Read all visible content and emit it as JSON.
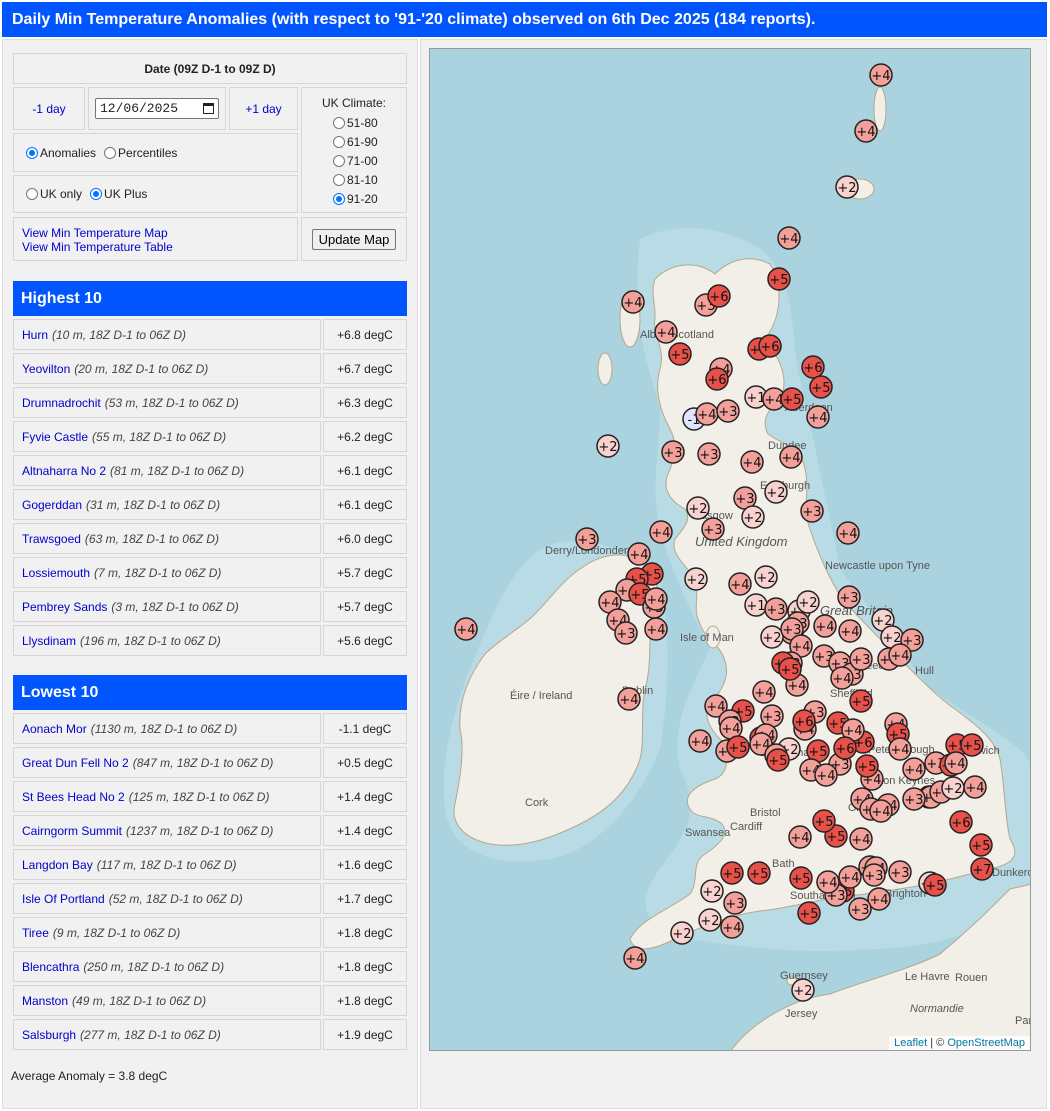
{
  "title": "Daily Min Temperature Anomalies (with respect to '91-'20 climate) observed on 6th Dec 2025 (184 reports).",
  "controls": {
    "date_header": "Date (09Z D-1 to 09Z D)",
    "prev_day": "-1 day",
    "next_day": "+1 day",
    "date_value": "12/06/2025",
    "mode_options": [
      "Anomalies",
      "Percentiles"
    ],
    "mode_selected": "Anomalies",
    "region_options": [
      "UK only",
      "UK Plus"
    ],
    "region_selected": "UK Plus",
    "climate_label": "UK Climate:",
    "climate_options": [
      "51-80",
      "61-90",
      "71-00",
      "81-10",
      "91-20"
    ],
    "climate_selected": "91-20",
    "map_link": "View Min Temperature Map",
    "table_link": "View Min Temperature Table",
    "update_button": "Update Map"
  },
  "highest": {
    "title": "Highest 10",
    "rows": [
      {
        "name": "Hurn",
        "meta": "(10 m, 18Z D-1 to 06Z D)",
        "value": "+6.8 degC"
      },
      {
        "name": "Yeovilton",
        "meta": "(20 m, 18Z D-1 to 06Z D)",
        "value": "+6.7 degC"
      },
      {
        "name": "Drumnadrochit",
        "meta": "(53 m, 18Z D-1 to 06Z D)",
        "value": "+6.3 degC"
      },
      {
        "name": "Fyvie Castle",
        "meta": "(55 m, 18Z D-1 to 06Z D)",
        "value": "+6.2 degC"
      },
      {
        "name": "Altnaharra No 2",
        "meta": "(81 m, 18Z D-1 to 06Z D)",
        "value": "+6.1 degC"
      },
      {
        "name": "Gogerddan",
        "meta": "(31 m, 18Z D-1 to 06Z D)",
        "value": "+6.1 degC"
      },
      {
        "name": "Trawsgoed",
        "meta": "(63 m, 18Z D-1 to 06Z D)",
        "value": "+6.0 degC"
      },
      {
        "name": "Lossiemouth",
        "meta": "(7 m, 18Z D-1 to 06Z D)",
        "value": "+5.7 degC"
      },
      {
        "name": "Pembrey Sands",
        "meta": "(3 m, 18Z D-1 to 06Z D)",
        "value": "+5.7 degC"
      },
      {
        "name": "Llysdinam",
        "meta": "(196 m, 18Z D-1 to 06Z D)",
        "value": "+5.6 degC"
      }
    ]
  },
  "lowest": {
    "title": "Lowest 10",
    "rows": [
      {
        "name": "Aonach Mor",
        "meta": "(1130 m, 18Z D-1 to 06Z D)",
        "value": "-1.1 degC"
      },
      {
        "name": "Great Dun Fell No 2",
        "meta": "(847 m, 18Z D-1 to 06Z D)",
        "value": "+0.5 degC"
      },
      {
        "name": "St Bees Head No 2",
        "meta": "(125 m, 18Z D-1 to 06Z D)",
        "value": "+1.4 degC"
      },
      {
        "name": "Cairngorm Summit",
        "meta": "(1237 m, 18Z D-1 to 06Z D)",
        "value": "+1.4 degC"
      },
      {
        "name": "Langdon Bay",
        "meta": "(117 m, 18Z D-1 to 06Z D)",
        "value": "+1.6 degC"
      },
      {
        "name": "Isle Of Portland",
        "meta": "(52 m, 18Z D-1 to 06Z D)",
        "value": "+1.7 degC"
      },
      {
        "name": "Tiree",
        "meta": "(9 m, 18Z D-1 to 06Z D)",
        "value": "+1.8 degC"
      },
      {
        "name": "Blencathra",
        "meta": "(250 m, 18Z D-1 to 06Z D)",
        "value": "+1.8 degC"
      },
      {
        "name": "Manston",
        "meta": "(49 m, 18Z D-1 to 06Z D)",
        "value": "+1.8 degC"
      },
      {
        "name": "Salsburgh",
        "meta": "(277 m, 18Z D-1 to 06Z D)",
        "value": "+1.9 degC"
      }
    ]
  },
  "average": "Average Anomaly = 3.8 degC",
  "map": {
    "place_labels": [
      "Dundee",
      "Edinburgh",
      "Glasgow",
      "United Kingdom",
      "Derry/Londonderry",
      "Newcastle upon Tyne",
      "Great Britain",
      "Isle of Man",
      "Éire / Ireland",
      "Dublin",
      "Cork",
      "Sheffield",
      "Birmingham",
      "Cardiff",
      "Bath",
      "Bristol",
      "Swansea",
      "Southampton",
      "Brighton",
      "Oxford",
      "Milton Keynes",
      "Peterborough",
      "Norwich",
      "Leeds",
      "Hull",
      "Aberdeen",
      "Alba / Scotland",
      "Guernsey",
      "Jersey",
      "Le Havre",
      "Rouen",
      "Normandie",
      "Dunkerque",
      "Paris"
    ],
    "marker_labels": [
      "+4",
      "+4",
      "+2",
      "+4",
      "+5",
      "+4",
      "+3",
      "+6",
      "+4",
      "+5",
      "+5",
      "+6",
      "+4",
      "+6",
      "+6",
      "+5",
      "+1",
      "+4",
      "+5",
      "+4",
      "-1",
      "+4",
      "+3",
      "+2",
      "+3",
      "+3",
      "+4",
      "+4",
      "+2",
      "+3",
      "+2",
      "+2",
      "+3",
      "+3",
      "+4",
      "+3",
      "+4",
      "+4",
      "+5",
      "+5",
      "+4",
      "+5",
      "+4",
      "+3",
      "+4",
      "+2",
      "+4",
      "+2",
      "+1",
      "+3",
      "+3",
      "+2",
      "+2",
      "+4",
      "+3",
      "+4",
      "+4",
      "+3",
      "+4",
      "+2",
      "+2",
      "+3",
      "+2",
      "+3",
      "+4",
      "+4",
      "+4",
      "+3",
      "+3",
      "+3",
      "+3",
      "+3",
      "+3",
      "+4",
      "+4",
      "+5",
      "+5",
      "+4",
      "+4",
      "+4",
      "+5",
      "+4",
      "+5",
      "+3",
      "+5",
      "+4",
      "+3",
      "+4",
      "+4",
      "+2",
      "+3",
      "+4",
      "+4",
      "+3",
      "+4",
      "+5",
      "+5",
      "+5",
      "+3",
      "+4",
      "+5",
      "+5",
      "+6",
      "+5",
      "+4",
      "+4",
      "+4",
      "+4",
      "+4",
      "+3",
      "+5",
      "+3",
      "+4",
      "+5",
      "+5",
      "+4",
      "+4",
      "+4",
      "+5",
      "+6",
      "+5",
      "+4",
      "+6",
      "+4",
      "+4",
      "+4",
      "+4",
      "+3",
      "+4",
      "+4",
      "+2",
      "+4",
      "+2",
      "+6",
      "+5",
      "+7",
      "+5",
      "+5",
      "+5",
      "+5",
      "+4",
      "+4",
      "+4",
      "+3",
      "+5",
      "+2",
      "+3",
      "+3",
      "+2",
      "+4",
      "+4",
      "+5",
      "+3",
      "+3",
      "+2",
      "+4",
      "+2"
    ],
    "attribution_leaflet": "Leaflet",
    "attribution_sep": " | © ",
    "attribution_osm": "OpenStreetMap"
  },
  "colors": {
    "header_blue": "#0055ff",
    "link_blue": "#0000cc",
    "sea": "#aad3df",
    "land": "#f2efe9",
    "anomaly_high": "#e8514a",
    "anomaly_mid": "#f4a09a",
    "anomaly_low": "#f8d2cf",
    "anomaly_negative": "#e0e4ff"
  }
}
